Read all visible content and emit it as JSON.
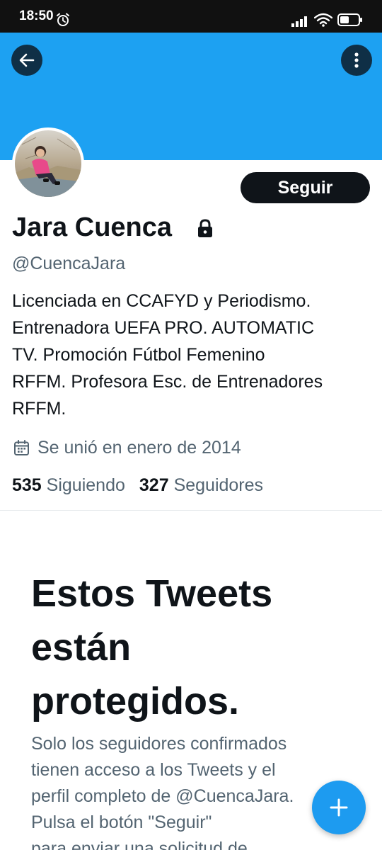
{
  "status_bar": {
    "time": "18:50",
    "icons": [
      "alarm-icon",
      "signal-icon",
      "wifi-icon",
      "battery-icon"
    ]
  },
  "banner": {
    "color": "#1da1f2",
    "back_icon": "arrow-left-icon",
    "more_icon": "more-vertical-icon"
  },
  "profile": {
    "follow_label": "Seguir",
    "name": "Jara Cuenca",
    "protected_icon": "lock-icon",
    "handle": "@CuencaJara",
    "bio_lines": [
      "Licenciada en CCAFYD y Periodismo.",
      "Entrenadora UEFA PRO. AUTOMATIC",
      "TV. Promoción Fútbol Femenino",
      "RFFM. Profesora Esc. de Entrenadores",
      "RFFM."
    ],
    "joined": "Se unió en enero de 2014",
    "following_count": "535",
    "following_label": "Siguiendo",
    "followers_count": "327",
    "followers_label": "Seguidores"
  },
  "protected_notice": {
    "title_lines": [
      "Estos Tweets",
      "están",
      "protegidos."
    ],
    "description_lines": [
      "Solo los seguidores confirmados",
      "tienen acceso a los Tweets y el",
      "perfil completo de @CuencaJara.",
      "Pulsa el botón \"Seguir\"",
      "para enviar una solicitud de"
    ]
  },
  "fab": {
    "icon": "compose-plus-icon",
    "color": "#1d9bf0"
  }
}
